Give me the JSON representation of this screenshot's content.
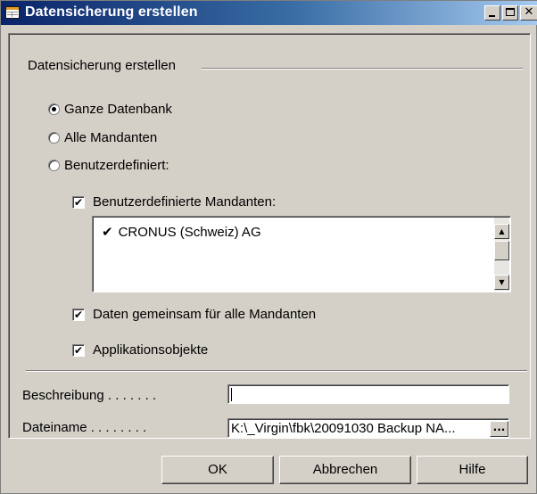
{
  "window": {
    "title": "Datensicherung erstellen",
    "controls": {
      "minimize": "_",
      "close": "✕"
    }
  },
  "group": {
    "title": "Datensicherung erstellen"
  },
  "options": {
    "radio_all_db": {
      "label": "Ganze Datenbank",
      "checked": true
    },
    "radio_all_clients": {
      "label": "Alle Mandanten",
      "checked": false
    },
    "radio_custom": {
      "label": "Benutzerdefiniert:",
      "checked": false
    }
  },
  "custom_clients": {
    "label": "Benutzerdefinierte Mandanten:",
    "checked": true,
    "check_glyph": "✔",
    "items": [
      {
        "check": "✔",
        "name": "CRONUS (Schweiz) AG"
      }
    ]
  },
  "scrollbar": {
    "up": "▲",
    "down": "▼"
  },
  "shared_data": {
    "label": "Daten gemeinsam für alle Mandanten",
    "checked": true,
    "check_glyph": "✔"
  },
  "app_objects": {
    "label": "Applikationsobjekte",
    "checked": true,
    "check_glyph": "✔"
  },
  "fields": {
    "description": {
      "label": "Beschreibung . . . . . . .",
      "value": ""
    },
    "filename": {
      "label": "Dateiname . . . . . . . .",
      "value": "K:\\_Virgin\\fbk\\20091030 Backup NA...",
      "browse": "..."
    }
  },
  "buttons": {
    "ok": "OK",
    "cancel": "Abbrechen",
    "help": "Hilfe"
  },
  "colors": {
    "dialog_bg": "#d4d0c8",
    "titlebar_start": "#0a246a",
    "titlebar_end": "#a6caf0"
  }
}
